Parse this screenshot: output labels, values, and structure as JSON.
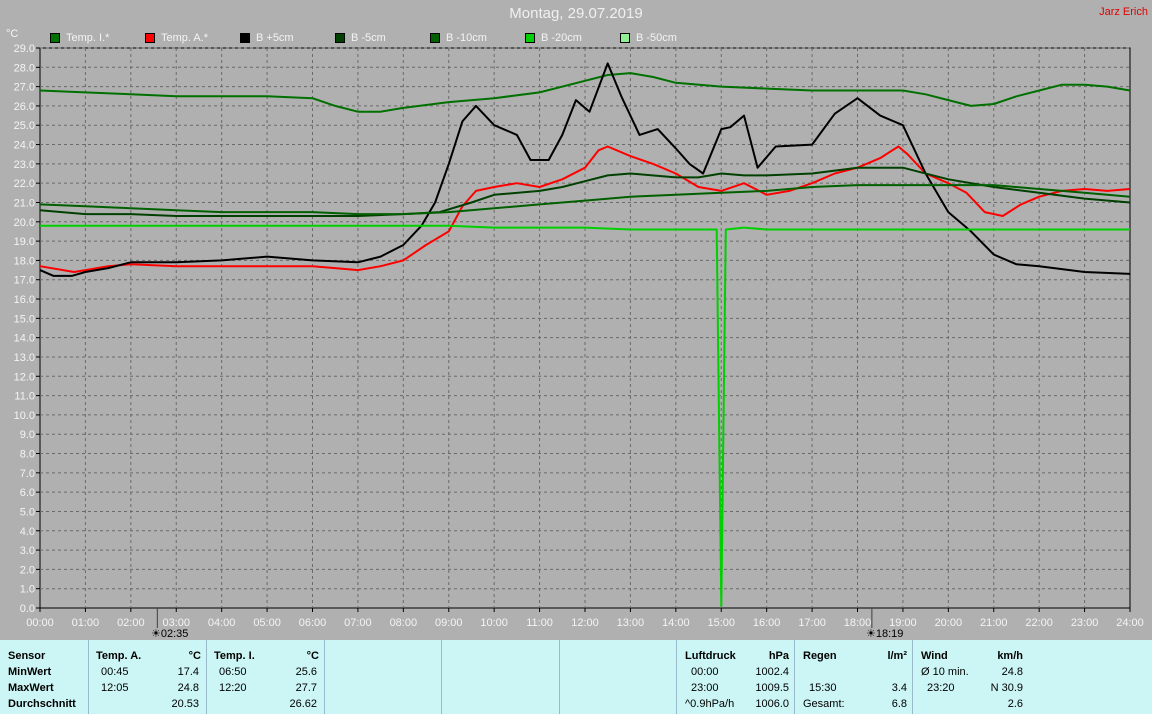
{
  "title": "Montag, 29.07.2019",
  "author": "Jarz Erich",
  "y_unit": "°C",
  "legend": [
    {
      "label": "Temp. I.*",
      "color": "#007000"
    },
    {
      "label": "Temp. A.*",
      "color": "#ff0000"
    },
    {
      "label": "B +5cm",
      "color": "#000000"
    },
    {
      "label": "B -5cm",
      "color": "#004000"
    },
    {
      "label": "B -10cm",
      "color": "#006000"
    },
    {
      "label": "B -20cm",
      "color": "#00d000"
    },
    {
      "label": "B -50cm",
      "color": "#90f090"
    }
  ],
  "markers": {
    "sunrise": "02:35",
    "sunset": "18:19"
  },
  "chart_data": {
    "type": "line",
    "ylim": [
      0,
      29
    ],
    "xlim": [
      0,
      24
    ],
    "y_ticks": [
      "0.0",
      "1.0",
      "2.0",
      "3.0",
      "4.0",
      "5.0",
      "6.0",
      "7.0",
      "8.0",
      "9.0",
      "10.0",
      "11.0",
      "12.0",
      "13.0",
      "14.0",
      "15.0",
      "16.0",
      "17.0",
      "18.0",
      "19.0",
      "20.0",
      "21.0",
      "22.0",
      "23.0",
      "24.0",
      "25.0",
      "26.0",
      "27.0",
      "28.0",
      "29.0"
    ],
    "x_ticks": [
      "00:00",
      "01:00",
      "02:00",
      "03:00",
      "04:00",
      "05:00",
      "06:00",
      "07:00",
      "08:00",
      "09:00",
      "10:00",
      "11:00",
      "12:00",
      "13:00",
      "14:00",
      "15:00",
      "16:00",
      "17:00",
      "18:00",
      "19:00",
      "20:00",
      "21:00",
      "22:00",
      "23:00",
      "24:00"
    ],
    "grid": true,
    "series": [
      {
        "name": "Temp. I.*",
        "color": "#007000",
        "points": [
          [
            0,
            26.8
          ],
          [
            1,
            26.7
          ],
          [
            2,
            26.6
          ],
          [
            3,
            26.5
          ],
          [
            4,
            26.5
          ],
          [
            5,
            26.5
          ],
          [
            6,
            26.4
          ],
          [
            6.5,
            26.0
          ],
          [
            7,
            25.7
          ],
          [
            7.5,
            25.7
          ],
          [
            8,
            25.9
          ],
          [
            9,
            26.2
          ],
          [
            10,
            26.4
          ],
          [
            11,
            26.7
          ],
          [
            12,
            27.3
          ],
          [
            12.5,
            27.6
          ],
          [
            13,
            27.7
          ],
          [
            13.5,
            27.5
          ],
          [
            14,
            27.2
          ],
          [
            15,
            27.0
          ],
          [
            16,
            26.9
          ],
          [
            17,
            26.8
          ],
          [
            18,
            26.8
          ],
          [
            19,
            26.8
          ],
          [
            19.5,
            26.6
          ],
          [
            20,
            26.3
          ],
          [
            20.5,
            26.0
          ],
          [
            21,
            26.1
          ],
          [
            21.5,
            26.5
          ],
          [
            22,
            26.8
          ],
          [
            22.5,
            27.1
          ],
          [
            23,
            27.1
          ],
          [
            23.5,
            27.0
          ],
          [
            24,
            26.8
          ]
        ]
      },
      {
        "name": "Temp. A.*",
        "color": "#ff0000",
        "points": [
          [
            0,
            17.7
          ],
          [
            0.75,
            17.4
          ],
          [
            1,
            17.5
          ],
          [
            1.5,
            17.7
          ],
          [
            2,
            17.8
          ],
          [
            3,
            17.7
          ],
          [
            4,
            17.7
          ],
          [
            5,
            17.7
          ],
          [
            6,
            17.7
          ],
          [
            6.5,
            17.6
          ],
          [
            7,
            17.5
          ],
          [
            7.5,
            17.7
          ],
          [
            8,
            18.0
          ],
          [
            8.5,
            18.8
          ],
          [
            9,
            19.5
          ],
          [
            9.3,
            20.8
          ],
          [
            9.6,
            21.6
          ],
          [
            10,
            21.8
          ],
          [
            10.5,
            22.0
          ],
          [
            11,
            21.8
          ],
          [
            11.5,
            22.2
          ],
          [
            12,
            22.8
          ],
          [
            12.3,
            23.7
          ],
          [
            12.5,
            23.9
          ],
          [
            13,
            23.4
          ],
          [
            13.5,
            23.0
          ],
          [
            14,
            22.5
          ],
          [
            14.5,
            21.8
          ],
          [
            15,
            21.6
          ],
          [
            15.5,
            22.0
          ],
          [
            16,
            21.4
          ],
          [
            16.5,
            21.6
          ],
          [
            17,
            22.0
          ],
          [
            17.5,
            22.5
          ],
          [
            18,
            22.8
          ],
          [
            18.5,
            23.3
          ],
          [
            18.9,
            23.9
          ],
          [
            19.1,
            23.5
          ],
          [
            19.5,
            22.5
          ],
          [
            20,
            22.0
          ],
          [
            20.4,
            21.5
          ],
          [
            20.8,
            20.5
          ],
          [
            21.2,
            20.3
          ],
          [
            21.6,
            20.9
          ],
          [
            22,
            21.3
          ],
          [
            22.5,
            21.6
          ],
          [
            23,
            21.7
          ],
          [
            23.5,
            21.6
          ],
          [
            24,
            21.7
          ]
        ]
      },
      {
        "name": "B +5cm",
        "color": "#000000",
        "points": [
          [
            0,
            17.5
          ],
          [
            0.3,
            17.2
          ],
          [
            0.7,
            17.2
          ],
          [
            1,
            17.4
          ],
          [
            1.5,
            17.6
          ],
          [
            2,
            17.9
          ],
          [
            3,
            17.9
          ],
          [
            4,
            18.0
          ],
          [
            5,
            18.2
          ],
          [
            6,
            18.0
          ],
          [
            7,
            17.9
          ],
          [
            7.5,
            18.2
          ],
          [
            8,
            18.8
          ],
          [
            8.4,
            19.8
          ],
          [
            8.7,
            21.0
          ],
          [
            9,
            23.0
          ],
          [
            9.3,
            25.2
          ],
          [
            9.6,
            26.0
          ],
          [
            10,
            25.0
          ],
          [
            10.5,
            24.5
          ],
          [
            10.8,
            23.2
          ],
          [
            11.2,
            23.2
          ],
          [
            11.5,
            24.5
          ],
          [
            11.8,
            26.3
          ],
          [
            12.1,
            25.7
          ],
          [
            12.5,
            28.2
          ],
          [
            12.8,
            26.5
          ],
          [
            13.2,
            24.5
          ],
          [
            13.6,
            24.8
          ],
          [
            14,
            23.8
          ],
          [
            14.3,
            23.0
          ],
          [
            14.6,
            22.5
          ],
          [
            15,
            24.8
          ],
          [
            15.2,
            24.9
          ],
          [
            15.5,
            25.5
          ],
          [
            15.8,
            22.8
          ],
          [
            16.2,
            23.9
          ],
          [
            17,
            24.0
          ],
          [
            17.5,
            25.6
          ],
          [
            18,
            26.4
          ],
          [
            18.5,
            25.5
          ],
          [
            19,
            25.0
          ],
          [
            19.5,
            22.5
          ],
          [
            20,
            20.5
          ],
          [
            20.5,
            19.5
          ],
          [
            21,
            18.3
          ],
          [
            21.5,
            17.8
          ],
          [
            22,
            17.7
          ],
          [
            23,
            17.4
          ],
          [
            24,
            17.3
          ]
        ]
      },
      {
        "name": "B -5cm",
        "color": "#004000",
        "points": [
          [
            0,
            20.6
          ],
          [
            1,
            20.4
          ],
          [
            2,
            20.4
          ],
          [
            3,
            20.3
          ],
          [
            4,
            20.3
          ],
          [
            5,
            20.3
          ],
          [
            6,
            20.3
          ],
          [
            7,
            20.3
          ],
          [
            8,
            20.4
          ],
          [
            8.8,
            20.5
          ],
          [
            9.5,
            21.0
          ],
          [
            10,
            21.4
          ],
          [
            11,
            21.6
          ],
          [
            11.5,
            21.8
          ],
          [
            12,
            22.1
          ],
          [
            12.5,
            22.4
          ],
          [
            13,
            22.5
          ],
          [
            14,
            22.3
          ],
          [
            14.5,
            22.3
          ],
          [
            15,
            22.5
          ],
          [
            15.5,
            22.4
          ],
          [
            16,
            22.4
          ],
          [
            17,
            22.5
          ],
          [
            18,
            22.8
          ],
          [
            19,
            22.8
          ],
          [
            20,
            22.2
          ],
          [
            21,
            21.8
          ],
          [
            22,
            21.5
          ],
          [
            23,
            21.2
          ],
          [
            24,
            21.0
          ]
        ]
      },
      {
        "name": "B -10cm",
        "color": "#006000",
        "points": [
          [
            0,
            20.9
          ],
          [
            1,
            20.8
          ],
          [
            2,
            20.7
          ],
          [
            3,
            20.6
          ],
          [
            4,
            20.5
          ],
          [
            5,
            20.5
          ],
          [
            6,
            20.5
          ],
          [
            7,
            20.4
          ],
          [
            8,
            20.4
          ],
          [
            9,
            20.5
          ],
          [
            10,
            20.7
          ],
          [
            11,
            20.9
          ],
          [
            12,
            21.1
          ],
          [
            13,
            21.3
          ],
          [
            14,
            21.4
          ],
          [
            15,
            21.5
          ],
          [
            16,
            21.6
          ],
          [
            17,
            21.8
          ],
          [
            18,
            21.9
          ],
          [
            19,
            21.9
          ],
          [
            20,
            21.9
          ],
          [
            21,
            21.9
          ],
          [
            22,
            21.7
          ],
          [
            23,
            21.5
          ],
          [
            24,
            21.3
          ]
        ]
      },
      {
        "name": "B -20cm",
        "color": "#00d000",
        "points": [
          [
            0,
            19.8
          ],
          [
            1,
            19.8
          ],
          [
            2,
            19.8
          ],
          [
            3,
            19.8
          ],
          [
            4,
            19.8
          ],
          [
            5,
            19.8
          ],
          [
            6,
            19.8
          ],
          [
            7,
            19.8
          ],
          [
            8,
            19.8
          ],
          [
            9,
            19.8
          ],
          [
            10,
            19.7
          ],
          [
            11,
            19.7
          ],
          [
            12,
            19.7
          ],
          [
            13,
            19.6
          ],
          [
            14,
            19.6
          ],
          [
            14.9,
            19.6
          ],
          [
            15.0,
            0.1
          ],
          [
            15.1,
            19.6
          ],
          [
            15.5,
            19.7
          ],
          [
            16,
            19.6
          ],
          [
            17,
            19.6
          ],
          [
            18,
            19.6
          ],
          [
            19,
            19.6
          ],
          [
            20,
            19.6
          ],
          [
            21,
            19.6
          ],
          [
            22,
            19.6
          ],
          [
            23,
            19.6
          ],
          [
            24,
            19.6
          ]
        ]
      },
      {
        "name": "B -50cm",
        "color": "#90f090",
        "points": []
      }
    ]
  },
  "table": {
    "sensor": {
      "header": "Sensor",
      "rows": [
        "MinWert",
        "MaxWert",
        "Durchschnitt"
      ]
    },
    "temp_a": {
      "header": "Temp. A.",
      "unit": "°C",
      "times": [
        "00:45",
        "12:05",
        ""
      ],
      "values": [
        "17.4",
        "24.8",
        "20.53"
      ]
    },
    "temp_i": {
      "header": "Temp. I.",
      "unit": "°C",
      "times": [
        "06:50",
        "12:20",
        ""
      ],
      "values": [
        "25.6",
        "27.7",
        "26.62"
      ]
    },
    "pressure": {
      "header": "Luftdruck",
      "unit": "hPa",
      "times": [
        "00:00",
        "23:00",
        "^0.9hPa/h"
      ],
      "values": [
        "1002.4",
        "1009.5",
        "1006.0"
      ]
    },
    "rain": {
      "header": "Regen",
      "unit": "l/m²",
      "times": [
        "",
        "15:30",
        "Gesamt:"
      ],
      "values": [
        "",
        "3.4",
        "6.8"
      ]
    },
    "wind": {
      "header": "Wind",
      "unit": "km/h",
      "times": [
        "Ø 10 min.",
        "23:20",
        ""
      ],
      "values": [
        "24.8",
        "N 30.9",
        "2.6"
      ]
    }
  }
}
